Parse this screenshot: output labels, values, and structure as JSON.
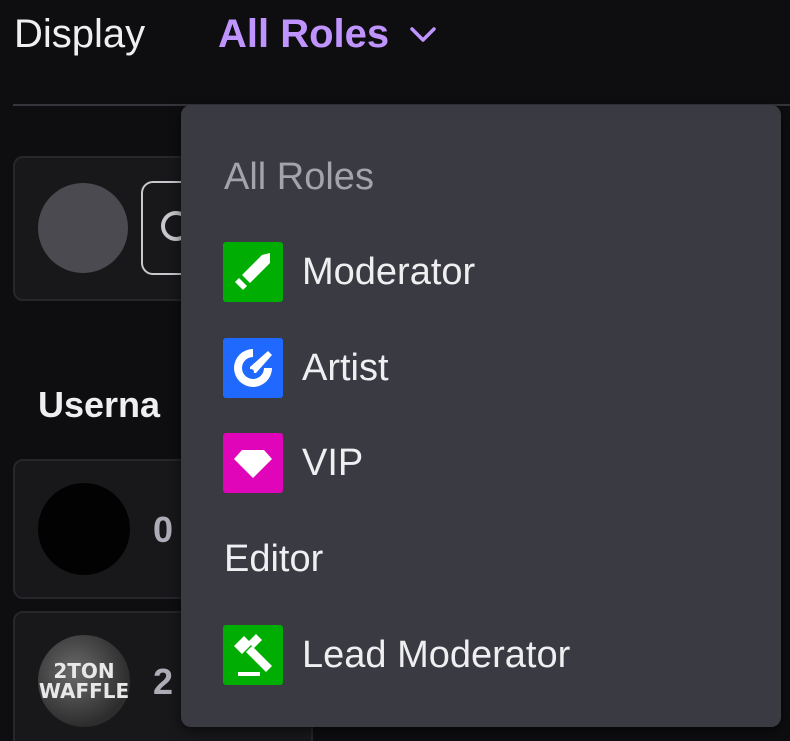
{
  "header": {
    "display_label": "Display",
    "role_filter_value": "All Roles"
  },
  "background": {
    "column_header": "Userna",
    "rows": [
      {
        "username_fragment": "0"
      },
      {
        "username_fragment": "2",
        "avatar_text_line1": "2TON",
        "avatar_text_line2": "WAFFLE"
      }
    ]
  },
  "dropdown": {
    "header": "All Roles",
    "items": [
      {
        "label": "Moderator",
        "icon": "sword-icon",
        "color": "#00ad03"
      },
      {
        "label": "Artist",
        "icon": "paintbrush-icon",
        "color": "#1f69ff"
      },
      {
        "label": "VIP",
        "icon": "gem-icon",
        "color": "#e005b9"
      },
      {
        "label": "Editor",
        "icon": ""
      },
      {
        "label": "Lead Moderator",
        "icon": "gavel-icon",
        "color": "#00ad03"
      }
    ]
  },
  "colors": {
    "accent": "#bf94ff",
    "background": "#0e0e10",
    "dropdown_bg": "#3a3a42"
  }
}
